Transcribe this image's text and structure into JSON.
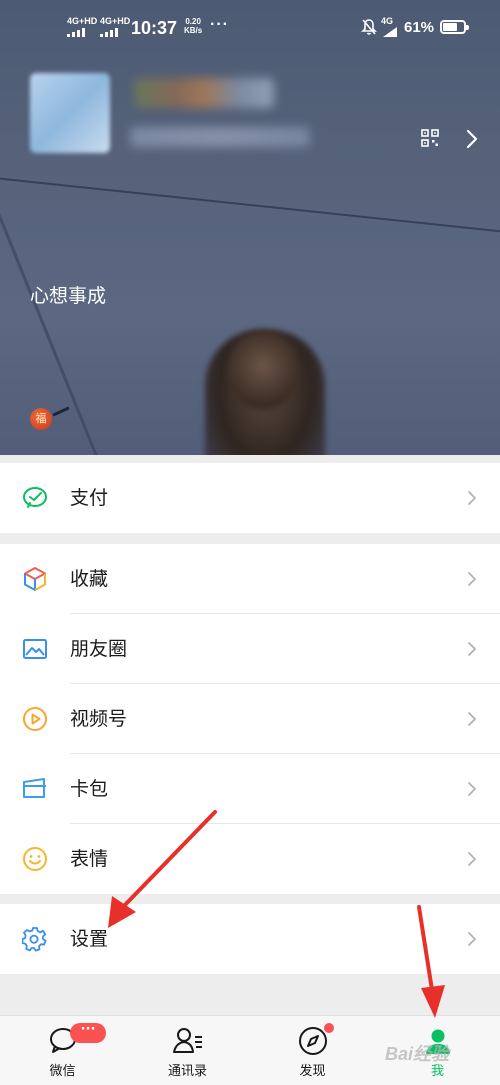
{
  "status_bar": {
    "sim1": "4G+HD",
    "sim2": "4G+HD",
    "time": "10:37",
    "speed_value": "0.20",
    "speed_unit": "KB/s",
    "more": "···",
    "sim_right": "4G",
    "battery": "61%"
  },
  "profile": {
    "motto": "心想事成",
    "badge": "福"
  },
  "menu": {
    "pay": "支付",
    "favorites": "收藏",
    "moments": "朋友圈",
    "channels": "视频号",
    "cards": "卡包",
    "stickers": "表情",
    "settings": "设置"
  },
  "tabbar": {
    "chats": "微信",
    "chats_badge": "···",
    "contacts": "通讯录",
    "discover": "发现",
    "me": "我"
  },
  "watermark": "Bai经验",
  "colors": {
    "accent_green": "#07c160",
    "badge_red": "#fa5151",
    "annotation_red": "#e8302a",
    "page_bg": "#ededed"
  }
}
